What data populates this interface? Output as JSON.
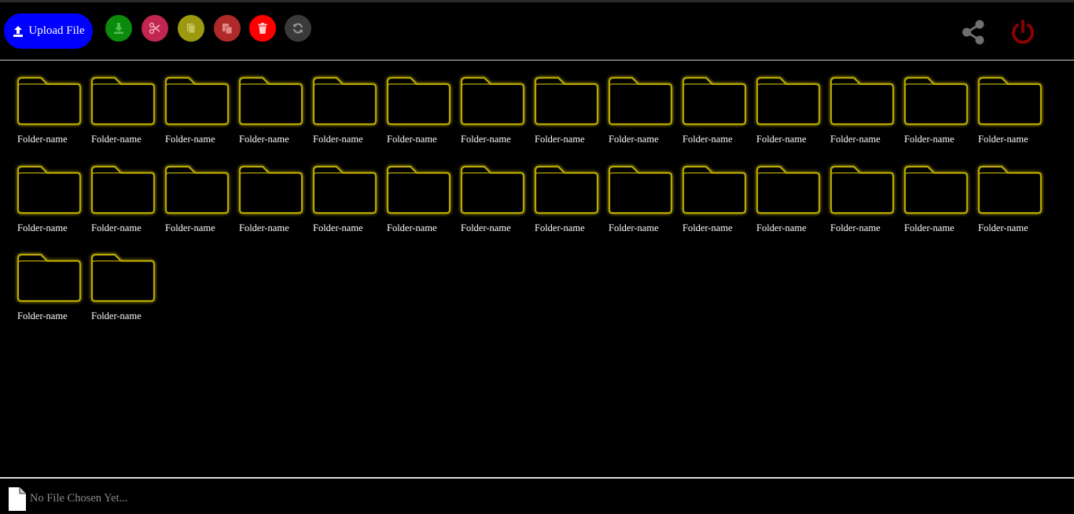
{
  "toolbar": {
    "upload_label": "Upload File",
    "upload_color": "#0000ff",
    "tools": [
      {
        "name": "download-button",
        "icon": "download-icon",
        "color": "#0b8a0b"
      },
      {
        "name": "cut-button",
        "icon": "scissors-icon",
        "color": "#c0264f"
      },
      {
        "name": "copy-button",
        "icon": "copy-icon",
        "color": "#9c9a10"
      },
      {
        "name": "paste-button",
        "icon": "paste-icon",
        "color": "#b02a2a"
      },
      {
        "name": "delete-button",
        "icon": "trash-icon",
        "color": "#ff0000"
      },
      {
        "name": "refresh-button",
        "icon": "refresh-icon",
        "color": "#3a3a3a"
      }
    ],
    "share_icon": "share-icon",
    "share_color": "#6f6f6f",
    "power_icon": "power-icon",
    "power_color": "#8b0000"
  },
  "folders": [
    "Folder-name",
    "Folder-name",
    "Folder-name",
    "Folder-name",
    "Folder-name",
    "Folder-name",
    "Folder-name",
    "Folder-name",
    "Folder-name",
    "Folder-name",
    "Folder-name",
    "Folder-name",
    "Folder-name",
    "Folder-name",
    "Folder-name",
    "Folder-name",
    "Folder-name",
    "Folder-name",
    "Folder-name",
    "Folder-name",
    "Folder-name",
    "Folder-name",
    "Folder-name",
    "Folder-name",
    "Folder-name",
    "Folder-name",
    "Folder-name",
    "Folder-name",
    "Folder-name",
    "Folder-name"
  ],
  "folder_glow_color": "#b8a800",
  "status": {
    "file_icon": "file-icon",
    "text": "No File Chosen Yet..."
  }
}
